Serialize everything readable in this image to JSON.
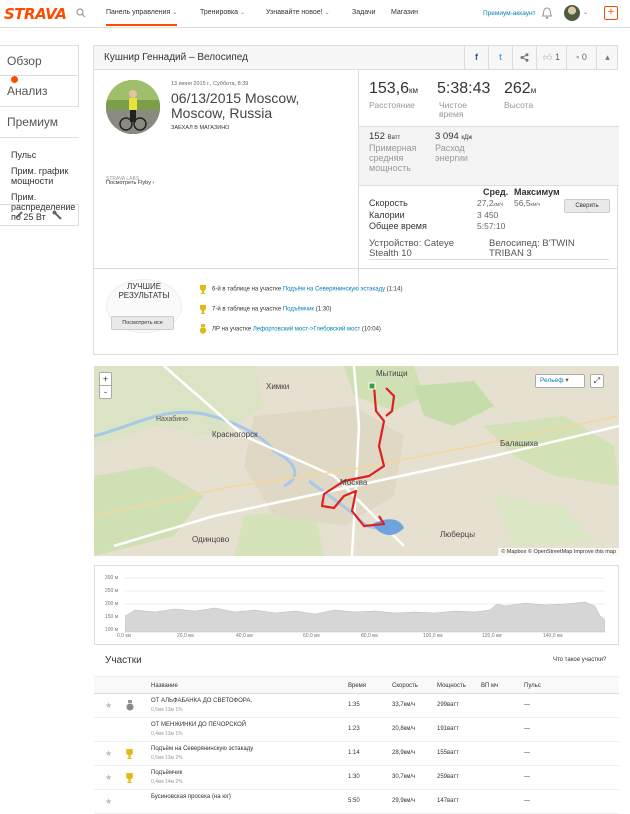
{
  "nav": {
    "logo": "STRAVA",
    "items": [
      "Панель управления",
      "Тренировка",
      "Узнавайте новое!",
      "Задачи",
      "Магазин"
    ],
    "premium": "Премиум-аккаунт",
    "plus": "+"
  },
  "sidebar": {
    "tabs": [
      "Обзор",
      "Анализ",
      "Премиум"
    ],
    "sub": [
      "Пульс",
      "Прим. график мощности",
      "Прим. распределение по 25 Вт"
    ]
  },
  "activity": {
    "header": "Кушнир Геннадий – Велосипед",
    "header_buttons": {
      "fb": "f",
      "tw": "t",
      "share": "<",
      "kudos": "1",
      "comments": "0"
    },
    "date_small": "13 июня 2015 г., Суббота, 8:39",
    "title": "06/13/2015 Moscow, Moscow, Russia",
    "tag": "ЗАЕХАЛ В МАГАЗИНО",
    "device_small": "STRAVA LABS",
    "show_flyby": "Посмотреть Flyby",
    "distance": {
      "value": "153,6",
      "unit": "км",
      "label": "Расстояние"
    },
    "moving_time": {
      "value": "5:38:43",
      "label": "Чистое время"
    },
    "elevation": {
      "value": "262",
      "unit": "м",
      "label": "Высота"
    },
    "power": {
      "value": "152",
      "unit": "Ватт",
      "label": "Примерная средняя мощность"
    },
    "energy": {
      "value": "3 094",
      "unit": "кДж",
      "label": "Расход энергии"
    },
    "avg_header": "Сред.",
    "max_header": "Максимум",
    "compare": "Сверить",
    "rows": [
      {
        "label": "Скорость",
        "avg": "27,2",
        "unit": "км/ч",
        "max": "56,5",
        "max_unit": "км/ч"
      },
      {
        "label": "Калории",
        "avg": "3 450",
        "max": ""
      },
      {
        "label": "Общее время",
        "avg": "5:57:10",
        "max": ""
      }
    ],
    "device": "Устройство: Cateye Stealth 10",
    "bike": "Велосипед: B'TWIN TRIBAN 3"
  },
  "best": {
    "title": "ЛУЧШИЕ РЕЗУЛЬТАТЫ",
    "button": "Посмотреть все",
    "items": [
      {
        "prefix": "6-й в таблице на участке",
        "link": "Подъём на Северянинскую эстакаду",
        "time": "(1:14)",
        "medal": "gold"
      },
      {
        "prefix": "7-й в таблице на участке",
        "link": "Подъёмчик",
        "time": "(1:30)",
        "medal": "gold"
      },
      {
        "prefix": "ЛР на участке",
        "link": "Лефортовский мост->Глебовский мост",
        "time": "(10:04)",
        "medal": "pr"
      }
    ]
  },
  "map": {
    "labels": [
      "Мытищи",
      "Химки",
      "Красногорск",
      "Балашиха",
      "Москва",
      "Одинцово",
      "Люберцы",
      "Нахабино"
    ],
    "layer": "Рельеф",
    "attribution": "© Mapbox © OpenStreetMap Improve this map",
    "zoom_in": "+",
    "zoom_out": "-"
  },
  "elevation_chart": {
    "y_ticks": [
      "300 м",
      "250 м",
      "200 м",
      "150 м",
      "100 м"
    ],
    "x_ticks": [
      "0,0 км",
      "20,0 км",
      "40,0 км",
      "60,0 км",
      "80,0 км",
      "100,0 км",
      "120,0 км",
      "140,0 км"
    ]
  },
  "segments": {
    "title": "Участки",
    "help": "Что такое участки?",
    "columns": [
      "Название",
      "Время",
      "Скорость",
      "Мощность",
      "ВП мч",
      "Пульс"
    ],
    "rows": [
      {
        "name": "ОТ АЛЬФАБАНКА ДО СВЕТОФОРА.",
        "meta": "0,5км  13м  1%",
        "time": "1:35",
        "speed": "33,7км/ч",
        "power": "299ватт",
        "vam": "",
        "hr": "—",
        "medal": "star"
      },
      {
        "name": "ОТ МЕНЖИНКИ ДО ПЕЧОРСКОЙ",
        "meta": "0,4км  13м  1%",
        "time": "1:23",
        "speed": "20,8км/ч",
        "power": "191ватт",
        "vam": "",
        "hr": "—",
        "medal": "none"
      },
      {
        "name": "Подъём на Северянинскую эстакаду",
        "meta": "0,5км  13м  2%",
        "time": "1:14",
        "speed": "28,9км/ч",
        "power": "155ватт",
        "vam": "",
        "hr": "—",
        "medal": "gold"
      },
      {
        "name": "Подъёмчик",
        "meta": "0,4км  14м  2%",
        "time": "1:30",
        "speed": "30,7км/ч",
        "power": "259ватт",
        "vam": "",
        "hr": "—",
        "medal": "gold"
      },
      {
        "name": "Бусиновская просека (на юг)",
        "meta": "",
        "time": "5:50",
        "speed": "29,9км/ч",
        "power": "147ватт",
        "vam": "",
        "hr": "—",
        "medal": "star"
      }
    ]
  }
}
